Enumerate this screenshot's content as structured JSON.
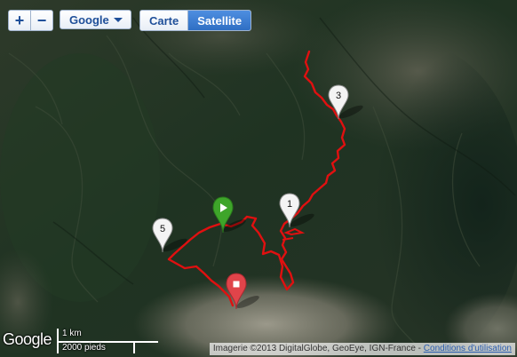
{
  "controls": {
    "zoom_in_label": "+",
    "zoom_out_label": "−",
    "provider_label": "Google",
    "map_types": [
      "Carte",
      "Satellite"
    ],
    "active_map_type": "Satellite"
  },
  "markers": {
    "waypoints": [
      {
        "label": "1"
      },
      {
        "label": "3"
      },
      {
        "label": "5"
      }
    ],
    "start_marker": "play-icon",
    "end_marker": "stop-icon"
  },
  "track": {
    "color": "#e01010"
  },
  "footer": {
    "logo_text": "Google",
    "scale_metric": "1 km",
    "scale_imperial": "2000 pieds",
    "attribution": "Imagerie ©2013 DigitalGlobe, GeoEye, IGN-France - ",
    "terms_link": "Conditions d'utilisation"
  },
  "colors": {
    "accent": "#2f6fc4",
    "start_pin": "#3ea52a",
    "end_pin": "#e0444a",
    "waypoint_pin": "#ffffff"
  }
}
